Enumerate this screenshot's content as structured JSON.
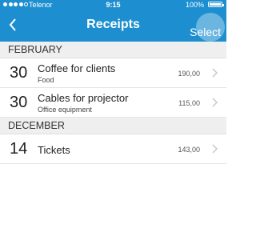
{
  "status": {
    "carrier": "Telenor",
    "time": "9:15",
    "battery": "100%"
  },
  "nav": {
    "title": "Receipts",
    "select_label": "Select",
    "back_icon": "chevron-left-icon"
  },
  "sections": [
    {
      "header": "FEBRUARY",
      "items": [
        {
          "day": "30",
          "title": "Coffee for clients",
          "category": "Food",
          "amount": "190,00"
        },
        {
          "day": "30",
          "title": "Cables for projector",
          "category": "Office equipment",
          "amount": "115,00"
        }
      ]
    },
    {
      "header": "DECEMBER",
      "items": [
        {
          "day": "14",
          "title": "Tickets",
          "category": "",
          "amount": "143,00"
        }
      ]
    }
  ],
  "colors": {
    "accent": "#1d8fd0",
    "section_bg": "#efefef"
  }
}
